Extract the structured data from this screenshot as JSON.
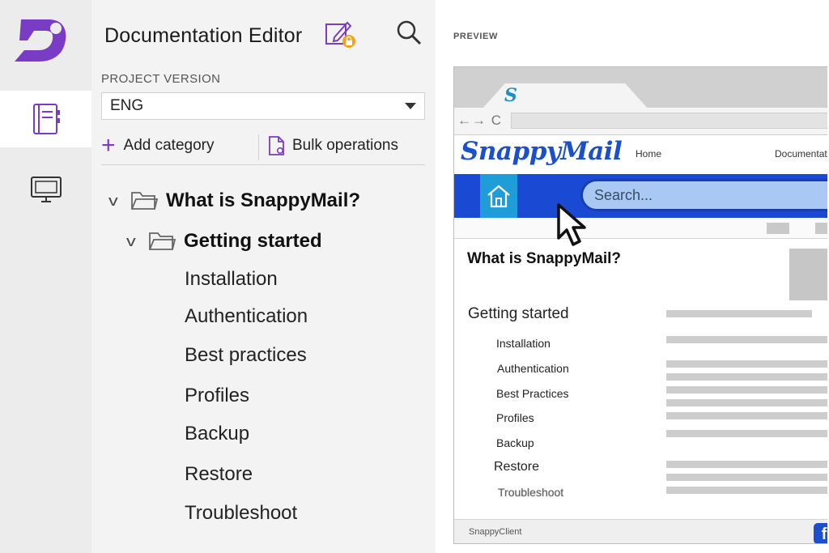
{
  "rail": {
    "logo_icon": "documentation-logo-icon",
    "items": [
      {
        "icon": "notebook-icon",
        "active": true
      },
      {
        "icon": "monitor-icon",
        "active": false
      }
    ]
  },
  "panel": {
    "title": "Documentation Editor",
    "title_icon": "edit-locked-icon",
    "search_icon": "search-icon",
    "version_label": "PROJECT VERSION",
    "version_value": "ENG",
    "add_category": "Add category",
    "bulk_operations": "Bulk operations",
    "tree": {
      "root": "What is SnappyMail?",
      "child": "Getting started",
      "leaves": [
        "Installation",
        "Authentication",
        "Best practices",
        "Profiles",
        "Backup",
        "Restore",
        "Troubleshoot"
      ]
    }
  },
  "preview": {
    "label": "PREVIEW",
    "tab_logo": "S",
    "nav_arrows": "←→ C",
    "site_logo": "SnappyMail",
    "nav": {
      "home": "Home",
      "docs": "Documentation"
    },
    "search_placeholder": "Search...",
    "title": "What is SnappyMail?",
    "section": "Getting started",
    "leaves": [
      "Installation",
      "Authentication",
      "Best Practices",
      "Profiles",
      "Backup",
      "Restore",
      "Troubleshoot"
    ],
    "footer": "SnappyClient",
    "footer_icon": "f"
  },
  "colors": {
    "accent": "#7a3cc4",
    "preview_band": "#1a49d4",
    "home_button": "#1f9dd8",
    "search_fill": "#a9c8f3"
  }
}
